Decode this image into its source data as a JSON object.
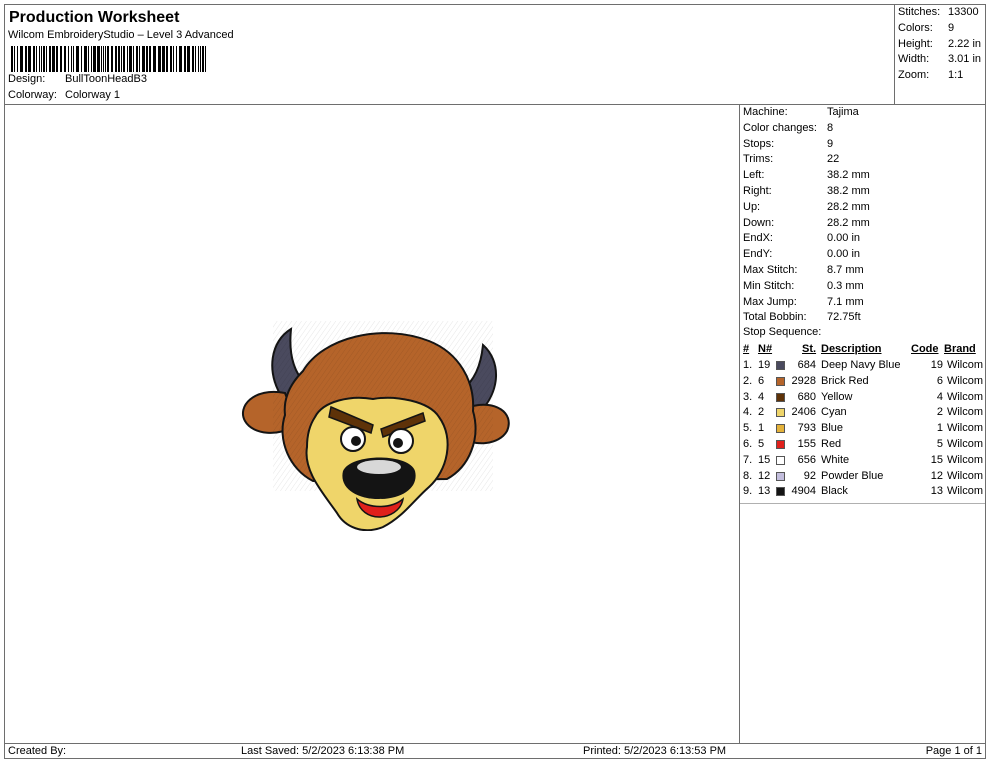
{
  "header": {
    "title": "Production Worksheet",
    "subtitle": "Wilcom EmbroideryStudio – Level 3 Advanced",
    "design_label": "Design:",
    "design_value": "BullToonHeadB3",
    "colorway_label": "Colorway:",
    "colorway_value": "Colorway 1"
  },
  "summary": [
    {
      "label": "Stitches:",
      "value": "13300"
    },
    {
      "label": "Colors:",
      "value": "9"
    },
    {
      "label": "Height:",
      "value": "2.22 in"
    },
    {
      "label": "Width:",
      "value": "3.01 in"
    },
    {
      "label": "Zoom:",
      "value": "1:1"
    }
  ],
  "details": [
    {
      "label": "Machine:",
      "value": "Tajima"
    },
    {
      "label": "Color changes:",
      "value": "8"
    },
    {
      "label": "Stops:",
      "value": "9"
    },
    {
      "label": "Trims:",
      "value": "22"
    },
    {
      "label": "Left:",
      "value": "38.2 mm"
    },
    {
      "label": "Right:",
      "value": "38.2 mm"
    },
    {
      "label": "Up:",
      "value": "28.2 mm"
    },
    {
      "label": "Down:",
      "value": "28.2 mm"
    },
    {
      "label": "EndX:",
      "value": "0.00 in"
    },
    {
      "label": "EndY:",
      "value": "0.00 in"
    },
    {
      "label": "Max Stitch:",
      "value": "8.7 mm"
    },
    {
      "label": "Min Stitch:",
      "value": "0.3 mm"
    },
    {
      "label": "Max Jump:",
      "value": "7.1 mm"
    },
    {
      "label": "Total Bobbin:",
      "value": "72.75ft"
    }
  ],
  "stop_sequence": {
    "title": "Stop Sequence:",
    "headers": {
      "num": "#",
      "n": "N#",
      "st": "St.",
      "desc": "Description",
      "code": "Code",
      "brand": "Brand"
    },
    "rows": [
      {
        "num": "1.",
        "n": "19",
        "color": "#4a4a5e",
        "st": "684",
        "desc": "Deep Navy Blue",
        "code": "19",
        "brand": "Wilcom"
      },
      {
        "num": "2.",
        "n": "6",
        "color": "#b5642a",
        "st": "2928",
        "desc": "Brick Red",
        "code": "6",
        "brand": "Wilcom"
      },
      {
        "num": "3.",
        "n": "4",
        "color": "#5e3208",
        "st": "680",
        "desc": "Yellow",
        "code": "4",
        "brand": "Wilcom"
      },
      {
        "num": "4.",
        "n": "2",
        "color": "#efd56a",
        "st": "2406",
        "desc": "Cyan",
        "code": "2",
        "brand": "Wilcom"
      },
      {
        "num": "5.",
        "n": "1",
        "color": "#e4b23a",
        "st": "793",
        "desc": "Blue",
        "code": "1",
        "brand": "Wilcom"
      },
      {
        "num": "6.",
        "n": "5",
        "color": "#e0201b",
        "st": "155",
        "desc": "Red",
        "code": "5",
        "brand": "Wilcom"
      },
      {
        "num": "7.",
        "n": "15",
        "color": "#ffffff",
        "st": "656",
        "desc": "White",
        "code": "15",
        "brand": "Wilcom"
      },
      {
        "num": "8.",
        "n": "12",
        "color": "#c3bedd",
        "st": "92",
        "desc": "Powder Blue",
        "code": "12",
        "brand": "Wilcom"
      },
      {
        "num": "9.",
        "n": "13",
        "color": "#141414",
        "st": "4904",
        "desc": "Black",
        "code": "13",
        "brand": "Wilcom"
      }
    ]
  },
  "footer": {
    "created_by": "Created By:",
    "last_saved": "Last Saved: 5/2/2023 6:13:38 PM",
    "printed": "Printed: 5/2/2023 6:13:53 PM",
    "page": "Page 1 of 1"
  }
}
